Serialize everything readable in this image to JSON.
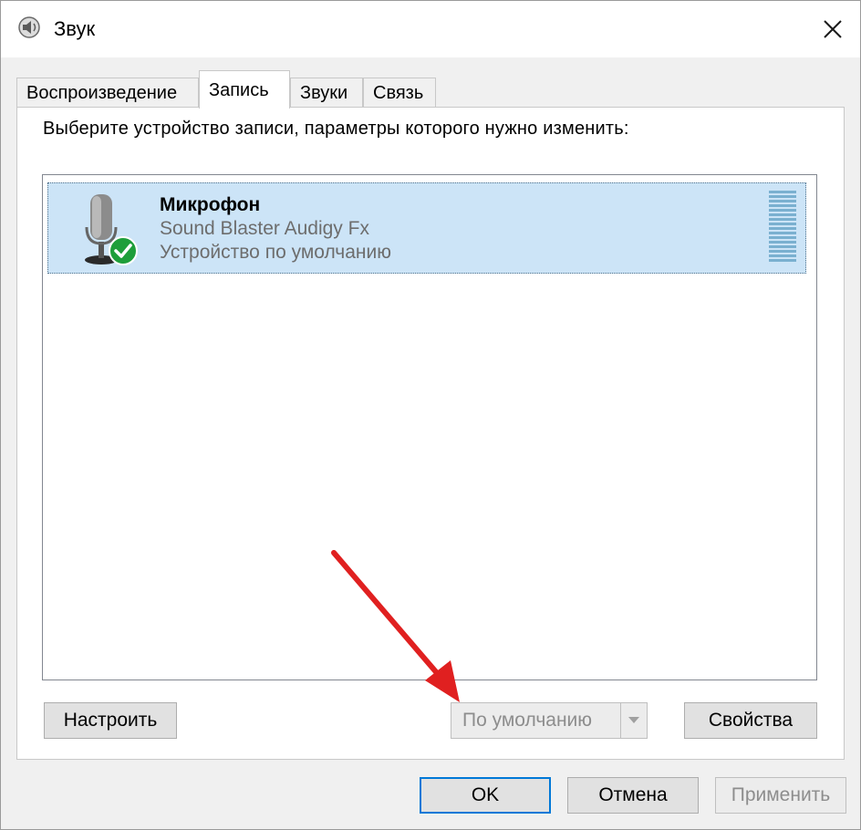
{
  "window": {
    "title": "Звук",
    "icon": "speaker-icon",
    "close_icon": "close-icon"
  },
  "tabs": [
    {
      "label": "Воспроизведение",
      "active": false
    },
    {
      "label": "Запись",
      "active": true
    },
    {
      "label": "Звуки",
      "active": false
    },
    {
      "label": "Связь",
      "active": false
    }
  ],
  "panel": {
    "instruction": "Выберите устройство записи, параметры которого нужно изменить:"
  },
  "devices": [
    {
      "name": "Микрофон",
      "hardware": "Sound Blaster Audigy Fx",
      "status": "Устройство по умолчанию",
      "icon": "microphone-icon",
      "badge_icon": "checkmark-icon",
      "selected": true
    }
  ],
  "panel_buttons": {
    "configure": "Настроить",
    "set_default": "По умолчанию",
    "properties": "Свойства"
  },
  "dialog_buttons": {
    "ok": "OK",
    "cancel": "Отмена",
    "apply": "Применить"
  },
  "colors": {
    "selection": "#cce4f7",
    "annotation_arrow": "#e02020",
    "default_badge": "#1e9e3a",
    "focus_border": "#0078d7"
  }
}
